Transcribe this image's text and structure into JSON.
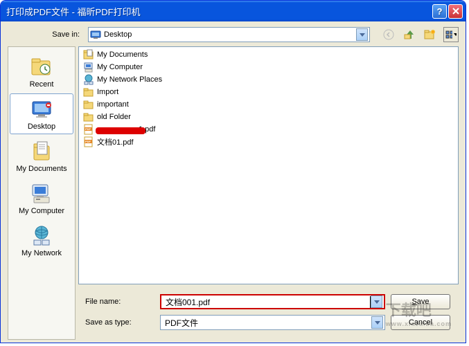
{
  "title": "打印成PDF文件 - 福昕PDF打印机",
  "savein": {
    "label": "Save in:",
    "value": "Desktop"
  },
  "places": [
    {
      "id": "recent",
      "label": "Recent"
    },
    {
      "id": "desktop",
      "label": "Desktop"
    },
    {
      "id": "mydocs",
      "label": "My Documents"
    },
    {
      "id": "mycomp",
      "label": "My Computer"
    },
    {
      "id": "mynet",
      "label": "My Network"
    }
  ],
  "files": [
    {
      "icon": "folder-docs",
      "name": "My Documents"
    },
    {
      "icon": "computer",
      "name": "My Computer"
    },
    {
      "icon": "network",
      "name": "My Network Places"
    },
    {
      "icon": "folder",
      "name": "Import"
    },
    {
      "icon": "folder",
      "name": "important"
    },
    {
      "icon": "folder",
      "name": "old Folder"
    },
    {
      "icon": "pdf",
      "name": "1.pdf",
      "redacted": true
    },
    {
      "icon": "pdf",
      "name": "文档01.pdf"
    }
  ],
  "form": {
    "filename_label": "File name:",
    "filename_value": "文档001.pdf",
    "type_label": "Save as type:",
    "type_value": "PDF文件",
    "save_btn": "Save",
    "cancel_btn": "Cancel"
  },
  "watermark": {
    "main": "下载吧",
    "sub": "www.xiazaiba.com"
  }
}
